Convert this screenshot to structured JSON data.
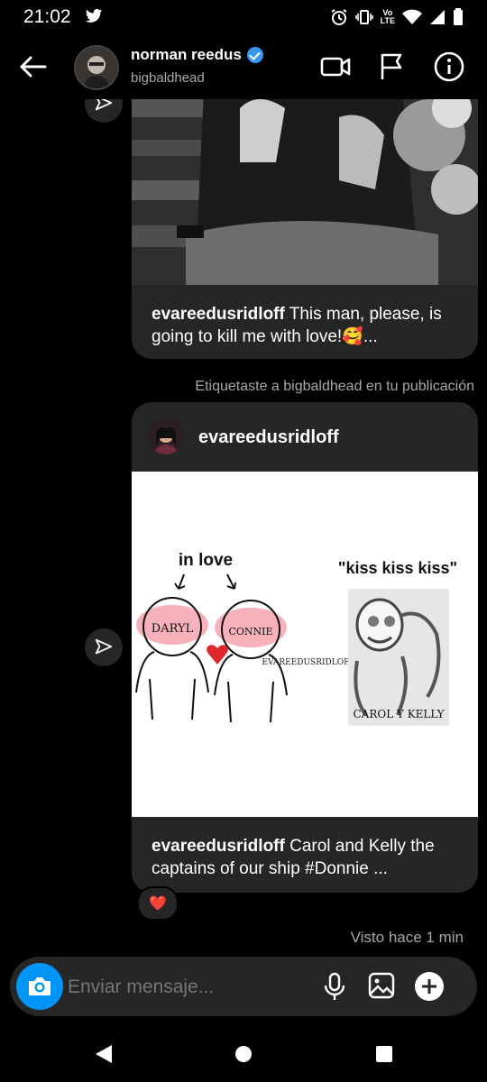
{
  "status_bar": {
    "time": "21:02",
    "icons": [
      "twitter-icon",
      "alarm-icon",
      "vibrate-icon",
      "volte-icon",
      "wifi-icon",
      "signal-icon",
      "battery-icon"
    ],
    "volte_label_top": "Vo",
    "volte_label_bottom": "LTE"
  },
  "header": {
    "name": "norman reedus",
    "username": "bigbaldhead",
    "verified": true,
    "actions": [
      "video-call-icon",
      "flag-icon",
      "info-icon"
    ]
  },
  "messages": {
    "post1": {
      "caption_user": "evareedusridloff",
      "caption_text": " This man, please, is going to kill me with love!🥰..."
    },
    "system_note": "Etiquetaste a bigbaldhead en tu publicación",
    "post2": {
      "author": "evareedusridloff",
      "image_text": {
        "in_love": "in love",
        "left_name": "DARYL",
        "right_name": "CONNIE",
        "watermark": "EVAREEDUSRIDLOFF",
        "kiss": "\"kiss kiss kiss\"",
        "carol_kelly": "CAROL Y KELLY"
      },
      "caption_user": "evareedusridloff",
      "caption_text": " Carol and Kelly the captains of our ship #Donnie ...",
      "reaction": "❤️"
    },
    "seen": "Visto hace 1 min"
  },
  "composer": {
    "placeholder": "Enviar mensaje..."
  },
  "colors": {
    "background": "#000000",
    "bubble": "#262626",
    "accent": "#0095f6",
    "verified": "#3897f0",
    "muted": "#a8a8a8"
  }
}
